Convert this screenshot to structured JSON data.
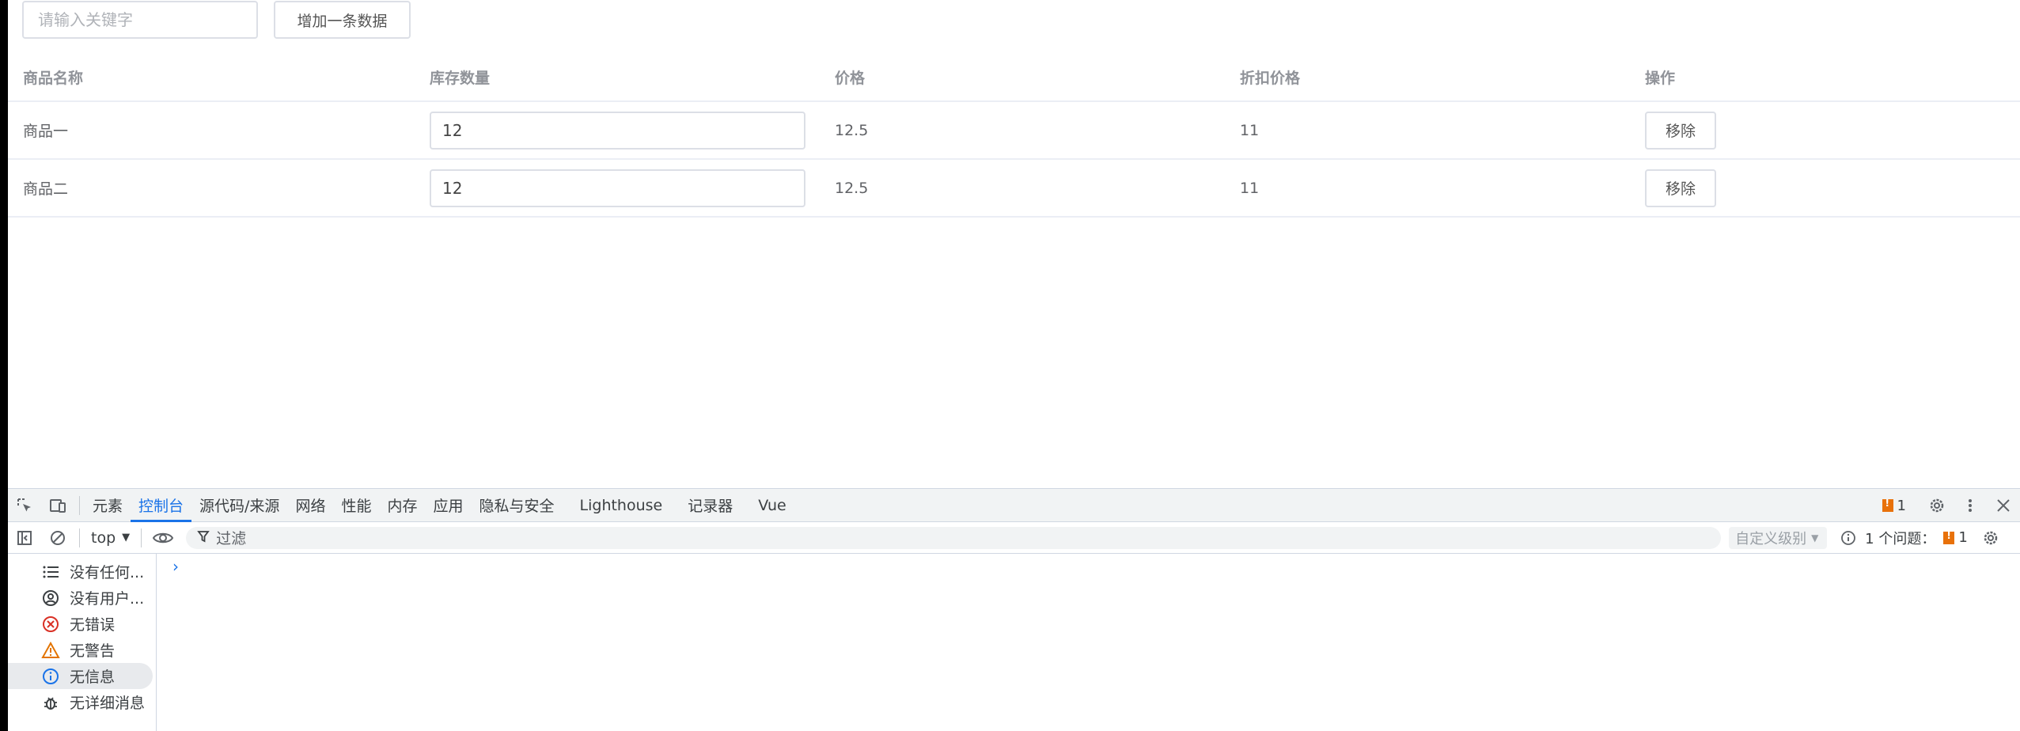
{
  "page": {
    "search": {
      "placeholder": "请输入关键字"
    },
    "add_button": "增加一条数据",
    "table": {
      "headers": [
        "商品名称",
        "库存数量",
        "价格",
        "折扣价格",
        "操作"
      ],
      "rows": [
        {
          "name": "商品一",
          "stock": "12",
          "price": "12.5",
          "discount": "11",
          "action": "移除"
        },
        {
          "name": "商品二",
          "stock": "12",
          "price": "12.5",
          "discount": "11",
          "action": "移除"
        }
      ]
    }
  },
  "devtools": {
    "tabs": [
      "元素",
      "控制台",
      "源代码/来源",
      "网络",
      "性能",
      "内存",
      "应用",
      "隐私与安全",
      "Lighthouse",
      "记录器",
      "Vue"
    ],
    "active_tab": "控制台",
    "issue_badge_count": "1",
    "context": "top",
    "filter_placeholder": "过滤",
    "level_select": "自定义级别",
    "issues_label": "1 个问题：",
    "issues_count": "1",
    "sidebar": [
      {
        "label": "没有任何...",
        "icon": "list-icon"
      },
      {
        "label": "没有用户...",
        "icon": "user-icon"
      },
      {
        "label": "无错误",
        "icon": "error-icon"
      },
      {
        "label": "无警告",
        "icon": "warning-icon"
      },
      {
        "label": "无信息",
        "icon": "info-icon"
      },
      {
        "label": "无详细消息",
        "icon": "bug-icon"
      }
    ],
    "colors": {
      "accent": "#1a73e8",
      "error": "#d93025",
      "warning": "#e37400",
      "issue": "#e8710a"
    }
  }
}
